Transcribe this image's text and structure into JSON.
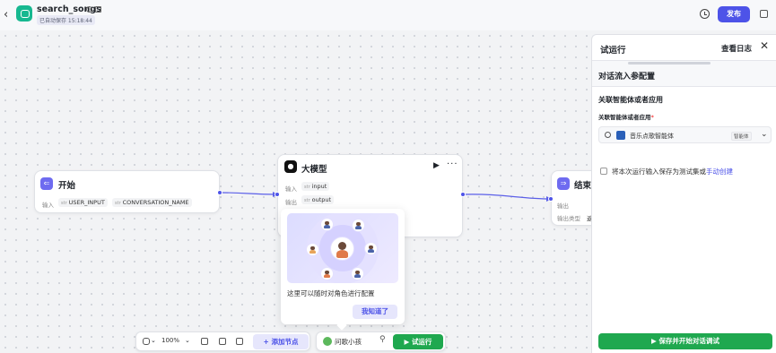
{
  "header": {
    "title": "search_songs",
    "autosave": "已自动保存 15:18:44",
    "publish_label": "发布"
  },
  "nodes": {
    "start": {
      "title": "开始",
      "input_label": "输入",
      "params": [
        "USER_INPUT",
        "CONVERSATION_NAME"
      ]
    },
    "llm": {
      "title": "大模型",
      "input_label": "输入",
      "input_param": "input",
      "output_label": "输出",
      "output_param": "output"
    },
    "end": {
      "title": "结束",
      "output_label": "输出",
      "output_type_label": "输出类型",
      "output_type_value": "返"
    }
  },
  "guide_popup": {
    "text": "这里可以随时对角色进行配置",
    "button_label": "我知道了"
  },
  "toolbar": {
    "zoom": "100%",
    "add_node_label": "添加节点",
    "agent_label": "问歌小孩",
    "trial_run_label": "试运行"
  },
  "panel": {
    "title": "试运行",
    "view_log_label": "查看日志",
    "section_title": "对话流入参配置",
    "linked_heading": "关联智能体或者应用",
    "field_label": "关联智能体或者应用",
    "required_mark": "*",
    "selected_app": "音乐点歌智能体",
    "selected_app_badge": "智能体",
    "checkbox_text": "将本次运行输入保存为测试集或",
    "checkbox_link": "手动创建",
    "save_button_label": "保存并开始对话调试"
  }
}
